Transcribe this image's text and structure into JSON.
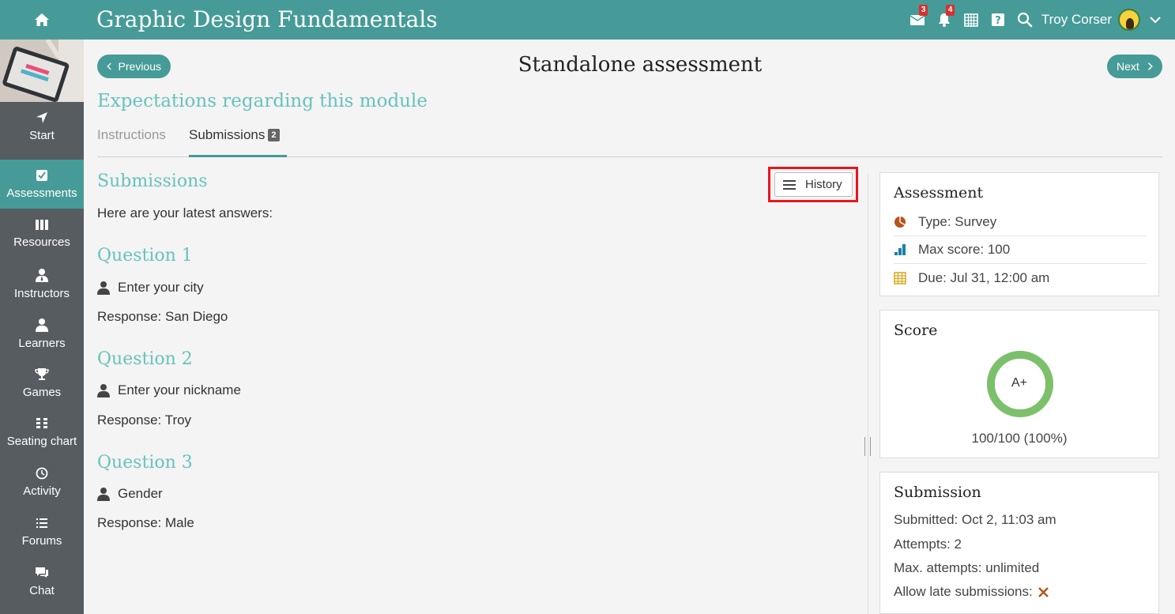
{
  "app": {
    "title": "Graphic Design Fundamentals"
  },
  "topbar": {
    "mail_badge": "3",
    "notif_badge": "4",
    "user_name": "Troy Corser"
  },
  "sidebar": {
    "items": [
      {
        "label": "Start",
        "icon": "navigate-arrow-icon",
        "active": false
      },
      {
        "label": "Assessments",
        "icon": "checkbox-icon",
        "active": true
      },
      {
        "label": "Resources",
        "icon": "books-icon",
        "active": false
      },
      {
        "label": "Instructors",
        "icon": "instructor-icon",
        "active": false
      },
      {
        "label": "Learners",
        "icon": "user-icon",
        "active": false
      },
      {
        "label": "Games",
        "icon": "trophy-icon",
        "active": false
      },
      {
        "label": "Seating chart",
        "icon": "seating-chart-icon",
        "active": false
      },
      {
        "label": "Activity",
        "icon": "clock-icon",
        "active": false
      },
      {
        "label": "Forums",
        "icon": "list-icon",
        "active": false
      },
      {
        "label": "Chat",
        "icon": "chat-icon",
        "active": false
      }
    ]
  },
  "nav": {
    "previous_label": "Previous",
    "next_label": "Next"
  },
  "page": {
    "title": "Standalone assessment",
    "module_title": "Expectations regarding this module"
  },
  "tabs": {
    "instructions_label": "Instructions",
    "submissions_label": "Submissions",
    "submissions_count": "2"
  },
  "submissions": {
    "heading": "Submissions",
    "history_label": "History",
    "intro": "Here are your latest answers:",
    "questions": [
      {
        "title": "Question 1",
        "prompt": "Enter your city",
        "response": "Response: San Diego"
      },
      {
        "title": "Question 2",
        "prompt": "Enter your nickname",
        "response": "Response: Troy"
      },
      {
        "title": "Question 3",
        "prompt": "Gender",
        "response": "Response: Male"
      }
    ]
  },
  "assessment_card": {
    "title": "Assessment",
    "type": "Type: Survey",
    "max_score": "Max score: 100",
    "due": "Due: Jul 31, 12:00 am"
  },
  "score_card": {
    "title": "Score",
    "grade": "A+",
    "score_text": "100/100 (100%)",
    "fraction": 1.0,
    "ring_color": "#7dc06b"
  },
  "submission_card": {
    "title": "Submission",
    "submitted": "Submitted: Oct 2, 11:03 am",
    "attempts": "Attempts: 2",
    "max_attempts": "Max. attempts: unlimited",
    "late_label": "Allow late submissions:",
    "late_allowed": false
  },
  "colors": {
    "accent": "#469b98",
    "accent_light": "#67c2bd",
    "sidebar": "#575c61",
    "badge": "#d9302f",
    "highlight_box": "#e8161d"
  }
}
